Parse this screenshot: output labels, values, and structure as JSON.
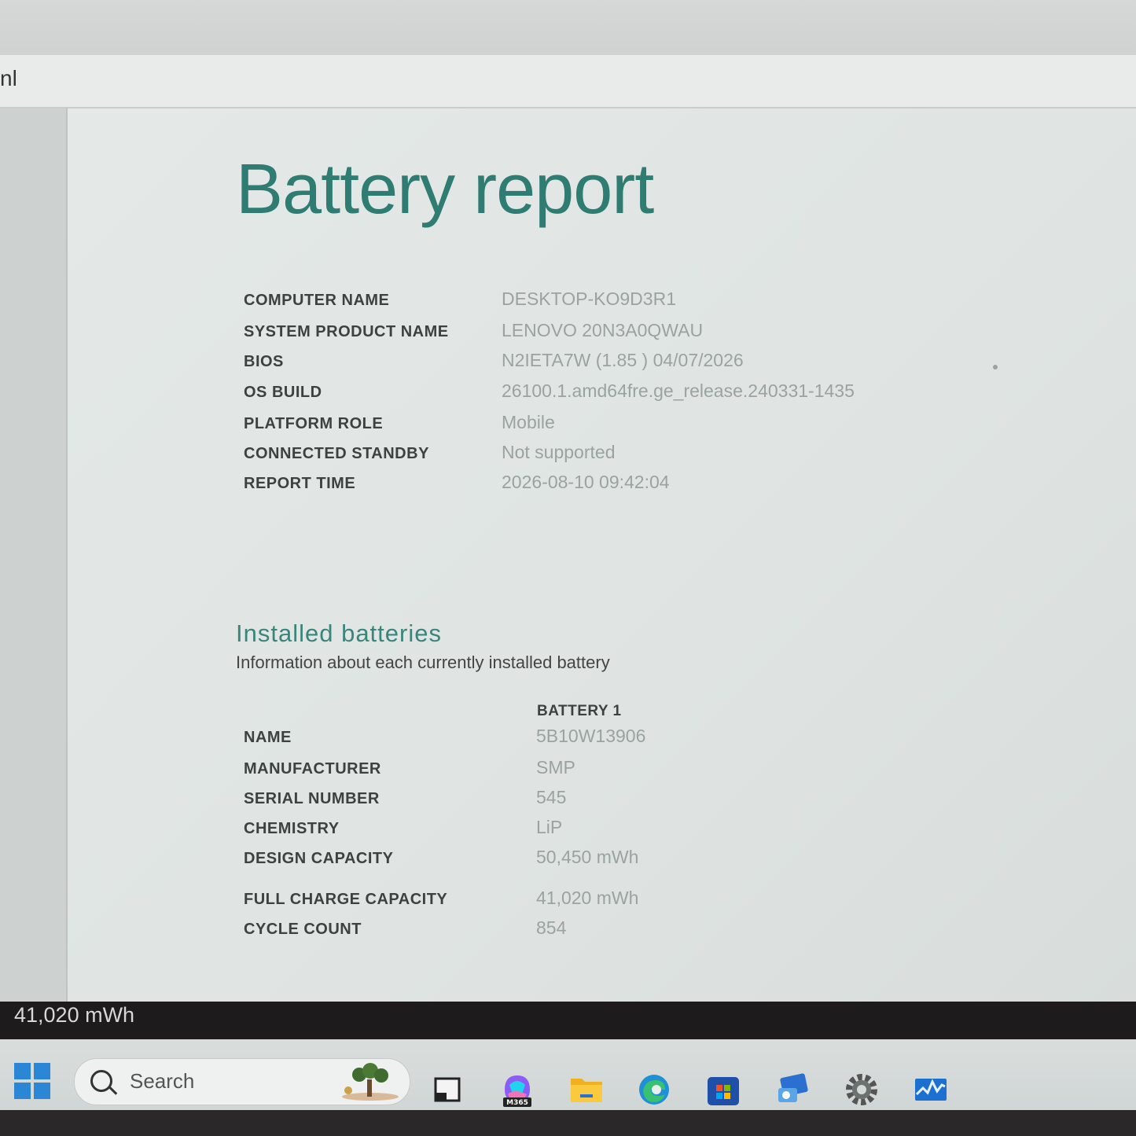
{
  "browser": {
    "url_fragment": "nl"
  },
  "report": {
    "title": "Battery report",
    "system": [
      {
        "label": "COMPUTER NAME",
        "value": "DESKTOP-KO9D3R1"
      },
      {
        "label": "SYSTEM PRODUCT NAME",
        "value": "LENOVO 20N3A0QWAU"
      },
      {
        "label": "BIOS",
        "value": "N2IETA7W (1.85 ) 04/07/2026"
      },
      {
        "label": "OS BUILD",
        "value": "26100.1.amd64fre.ge_release.240331-1435"
      },
      {
        "label": "PLATFORM ROLE",
        "value": "Mobile"
      },
      {
        "label": "CONNECTED STANDBY",
        "value": "Not supported"
      },
      {
        "label": "REPORT TIME",
        "value": "2026-08-10  09:42:04"
      }
    ],
    "installed": {
      "heading": "Installed batteries",
      "subheading": "Information about each currently installed battery",
      "column_header": "BATTERY 1",
      "rows": [
        {
          "label": "NAME",
          "value": "5B10W13906"
        },
        {
          "label": "MANUFACTURER",
          "value": "SMP"
        },
        {
          "label": "SERIAL NUMBER",
          "value": "545"
        },
        {
          "label": "CHEMISTRY",
          "value": "LiP"
        },
        {
          "label": "DESIGN CAPACITY",
          "value": "50,450 mWh"
        },
        {
          "label": "FULL CHARGE CAPACITY",
          "value": "41,020 mWh"
        },
        {
          "label": "CYCLE COUNT",
          "value": "854"
        }
      ]
    }
  },
  "overlay_text": "41,020 mWh",
  "taskbar": {
    "search_label": "Search",
    "copilot_badge": "M365",
    "accent": "#2b86d6"
  }
}
